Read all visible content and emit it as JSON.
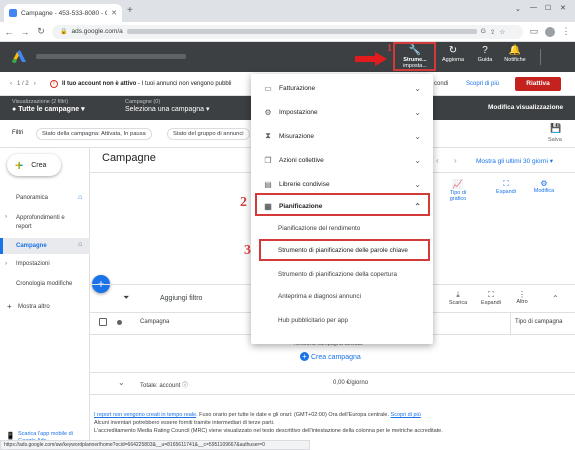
{
  "browser": {
    "tab_title": "Campagne - 453-533-8080 - Go",
    "url_prefix": "ads.google.com/a",
    "new_tab": "+",
    "window_controls": [
      "⌄",
      "—",
      "☐",
      "✕"
    ]
  },
  "header": {
    "tools_label": "Strume... impostа...",
    "tools_line1": "Strume...",
    "tools_line2": "imposta...",
    "refresh_label": "Aggiorna",
    "help_label": "Guida",
    "notifications_label": "Notifiche"
  },
  "warning": {
    "pager": "1 / 2",
    "text_bold": "Il tuo account non è attivo",
    "text_rest": " - I tuoi annunci non vengono pubbli",
    "right_text": "condi",
    "learn_more": "Scopri di più",
    "reactivate": "Riattiva"
  },
  "viewbar": {
    "view_label": "Visualizzazione (2 filtri)",
    "view_value": "Tutte le campagne",
    "campaigns_label": "Campagne (0)",
    "campaigns_value": "Seleziona una campagna",
    "modify_view": "Modifica visualizzazione"
  },
  "filters": {
    "label": "Filtri",
    "chip1": "Stato della campagna: Attivata, In pausa",
    "chip2": "Stato del gruppo di annunci",
    "save": "Salva"
  },
  "sidebar": {
    "create": "Crea",
    "items": [
      "Panoramica",
      "Approfondimenti e report",
      "Campagne",
      "Impostazioni",
      "Cronologia modifiche",
      "Mostra altro"
    ],
    "app_promo_1": "Scarica l'app mobile di",
    "app_promo_2": "Google Ads"
  },
  "main": {
    "title": "Campagne",
    "date_range": "Mostra gli ultimi 30 giorni",
    "chart_tools": [
      "Tipo di grafico",
      "Espandi",
      "Modifica"
    ],
    "add_filter": "Aggiungi filtro",
    "table_tools": [
      "Scarica",
      "Espandi",
      "Altro"
    ],
    "col_campaign": "Campagna",
    "col_type": "Tipo di campagna",
    "empty_text": "Nessuna campagna attivata",
    "create_campaign": "Crea campagna",
    "total_label": "Totale: account",
    "total_value": "0,00 €/giorno"
  },
  "footer": {
    "line1_link": "I report non vengono creati in tempo reale",
    "line1_rest": ". Fuso orario per tutte le date e gli orari: (GMT+02:00) Ora dell'Europa centrale. ",
    "line1_more": "Scopri di più",
    "line2": "Alcuni inventari potrebbero essere forniti tramite intermediari di terze parti.",
    "line3": "L'accreditamento Media Rating Council (MRC) viene visualizzato nel testo descrittivo dell'intestazione della colonna per le metriche accreditate."
  },
  "status_url": "https://ads.google.com/aw/keywordplanner/home?ocid=664225803&__u=8165611741&__c=5951109667&authuser=0",
  "menu": {
    "categories": [
      "Fatturazione",
      "Impostazione",
      "Misurazione",
      "Azioni collettive",
      "Librerie condivise",
      "Pianificazione"
    ],
    "planning_items": [
      "Pianificazione del rendimento",
      "Strumento di pianificazione delle parole chiave",
      "Strumento di pianificazione della copertura",
      "Anteprima e diagnosi annunci",
      "Hub pubblicitario per app"
    ]
  },
  "callouts": [
    "1",
    "2",
    "3"
  ],
  "colors": {
    "accent": "#1a73e8",
    "header": "#3c4043",
    "annotation_red": "#d33b3b",
    "reactivate": "#c5221f"
  }
}
